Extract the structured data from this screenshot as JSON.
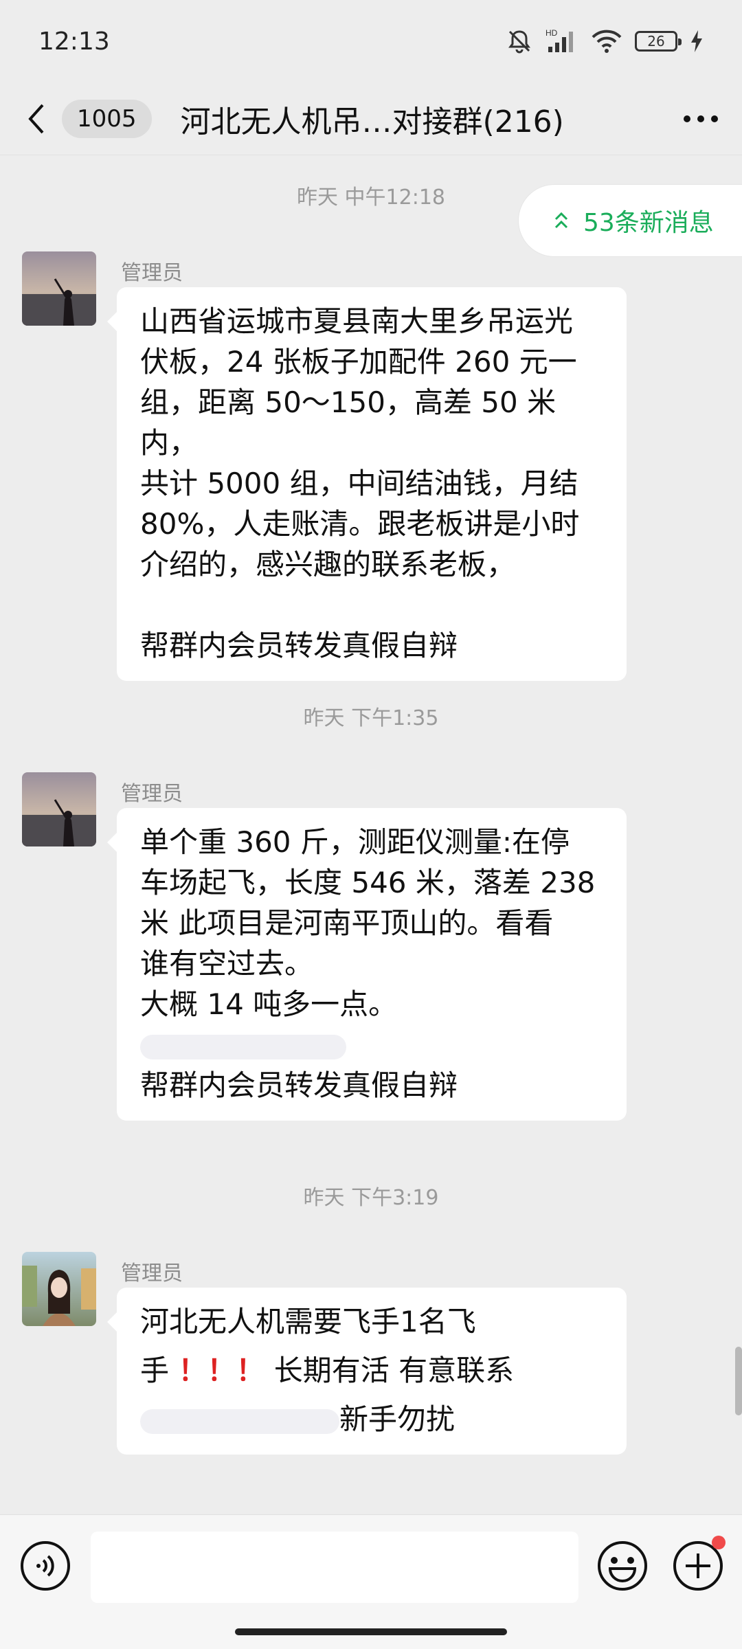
{
  "status_bar": {
    "time": "12:13",
    "battery": "26"
  },
  "header": {
    "unread_count": "1005",
    "title": "河北无人机吊…对接群(216)"
  },
  "new_messages_pill": "53条新消息",
  "messages": [
    {
      "timestamp": "昨天 中午12:18",
      "sender": "管理员",
      "lines": [
        "山西省运城市夏县南大里乡吊运光",
        "伏板，24 张板子加配件 260 元一",
        "组，距离 50～150，高差 50 米内，",
        "共计 5000 组，中间结油钱，月结",
        "80%，人走账清。跟老板讲是小时",
        "介绍的，感兴趣的联系老板，"
      ],
      "footer": "帮群内会员转发真假自辩"
    },
    {
      "timestamp": "昨天 下午1:35",
      "sender": "管理员",
      "lines": [
        "单个重 360 斤，测距仪测量:在停",
        "车场起飞，长度 546 米，落差 238",
        "米  此项目是河南平顶山的。看看",
        "谁有空过去。",
        "大概 14 吨多一点。"
      ],
      "footer": "帮群内会员转发真假自辩"
    },
    {
      "timestamp": "昨天 下午3:19",
      "sender": "管理员",
      "line1_prefix": "河北",
      "line1_suffix": "无人机需要飞手1名飞",
      "line2_prefix": "手",
      "line2_exclaims": "！！！",
      "line2_suffix": "长期有活 有意联系",
      "line3_suffix": "新手勿扰"
    }
  ]
}
